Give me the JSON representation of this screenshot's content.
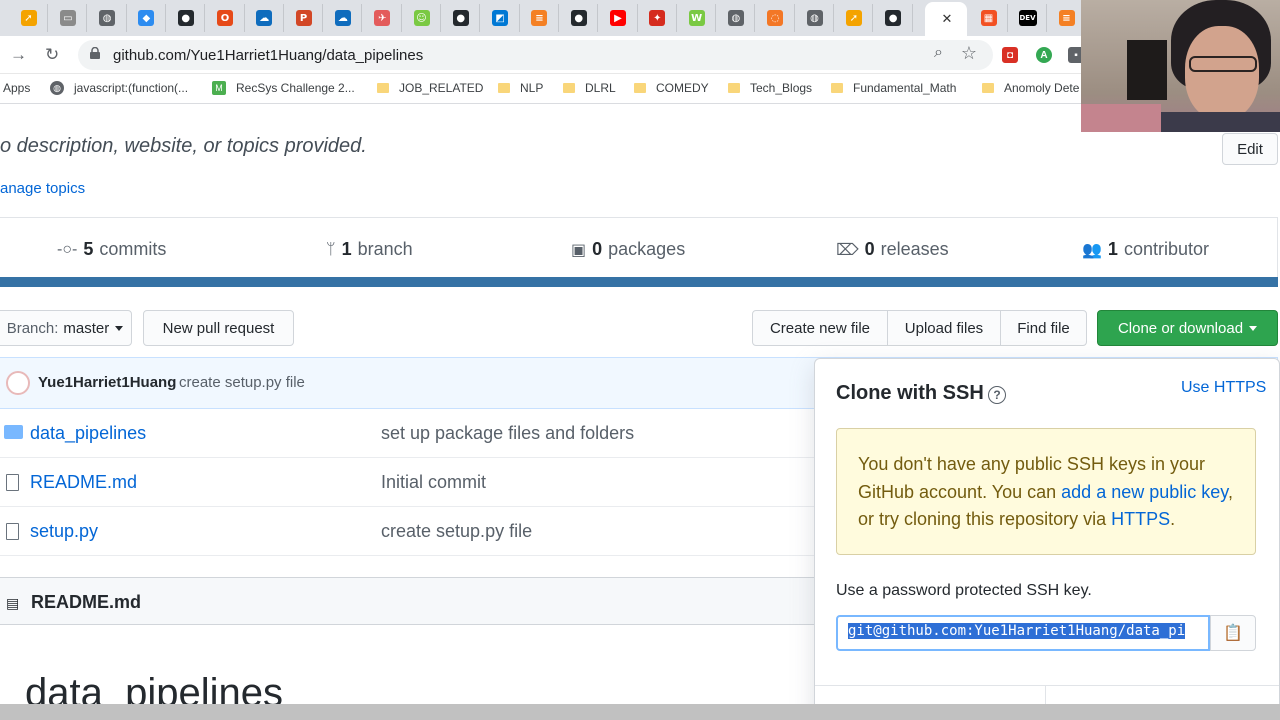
{
  "browser": {
    "url": "github.com/Yue1Harriet1Huang/data_pipelines",
    "tabs": [
      {
        "icon": "arrow-icon",
        "color": "#f4a300"
      },
      {
        "icon": "screen-icon",
        "color": "#8a8a8a"
      },
      {
        "icon": "globe-icon",
        "color": "#5f6368"
      },
      {
        "icon": "shield-icon",
        "color": "#2d8cf0"
      },
      {
        "icon": "github-icon",
        "color": "#24292e"
      },
      {
        "icon": "office-icon",
        "color": "#e64a19"
      },
      {
        "icon": "onedrive-icon",
        "color": "#0f6cbd"
      },
      {
        "icon": "powerpoint-icon",
        "color": "#d24726"
      },
      {
        "icon": "onedrive-icon",
        "color": "#0f6cbd"
      },
      {
        "icon": "paper-icon",
        "color": "#e35b5b"
      },
      {
        "icon": "smiley-icon",
        "color": "#7ac943"
      },
      {
        "icon": "github-icon",
        "color": "#24292e"
      },
      {
        "icon": "azure-icon",
        "color": "#0078d4"
      },
      {
        "icon": "stackoverflow-icon",
        "color": "#f48024"
      },
      {
        "icon": "github-icon",
        "color": "#24292e"
      },
      {
        "icon": "youtube-icon",
        "color": "#ff0000"
      },
      {
        "icon": "maple-leaf-icon",
        "color": "#d52b1e"
      },
      {
        "icon": "w-icon",
        "color": "#7ac943"
      },
      {
        "icon": "globe-icon",
        "color": "#5f6368"
      },
      {
        "icon": "jupyter-icon",
        "color": "#f37726"
      },
      {
        "icon": "globe-icon",
        "color": "#5f6368"
      },
      {
        "icon": "arrow-icon",
        "color": "#f4a300"
      },
      {
        "icon": "github-icon",
        "color": "#24292e"
      }
    ],
    "extra_tabs": [
      {
        "icon": "windows-icon",
        "color": "#f25022"
      },
      {
        "icon": "dev-icon",
        "color": "#000000",
        "label": "DEV"
      },
      {
        "icon": "stackoverflow-icon",
        "color": "#f48024"
      }
    ]
  },
  "bookmarks": [
    {
      "label": "Apps",
      "kind": "apps"
    },
    {
      "label": "javascript:(function(...",
      "kind": "globe"
    },
    {
      "label": "RecSys Challenge 2...",
      "kind": "m"
    },
    {
      "label": "JOB_RELATED",
      "kind": "folder"
    },
    {
      "label": "NLP",
      "kind": "folder"
    },
    {
      "label": "DLRL",
      "kind": "folder"
    },
    {
      "label": "COMEDY",
      "kind": "folder"
    },
    {
      "label": "Tech_Blogs",
      "kind": "folder"
    },
    {
      "label": "Fundamental_Math",
      "kind": "folder"
    },
    {
      "label": "Anomoly Dete",
      "kind": "folder"
    }
  ],
  "repo": {
    "description": "o description, website, or topics provided.",
    "manage_topics": "anage topics",
    "edit_label": "Edit",
    "stats": {
      "commits_count": "5",
      "commits_label": "commits",
      "branch_count": "1",
      "branch_label": "branch",
      "packages_count": "0",
      "packages_label": "packages",
      "releases_count": "0",
      "releases_label": "releases",
      "contributors_count": "1",
      "contributors_label": "contributor"
    },
    "branch_prefix": "Branch:",
    "branch_name": "master",
    "new_pr": "New pull request",
    "create_file": "Create new file",
    "upload_files": "Upload files",
    "find_file": "Find file",
    "clone_download": "Clone or download",
    "latest_commit": {
      "user": "Yue1Harriet1Huang",
      "message": "create setup.py file"
    },
    "files": [
      {
        "name": "data_pipelines",
        "message": "set up package files and folders",
        "type": "dir"
      },
      {
        "name": "README.md",
        "message": "Initial commit",
        "type": "file"
      },
      {
        "name": "setup.py",
        "message": "create setup.py file",
        "type": "file"
      }
    ],
    "readme_title": "README.md",
    "readme_heading": "data_pipelines"
  },
  "clone": {
    "title": "Clone with SSH",
    "use_https": "Use HTTPS",
    "flash_part1": "You don't have any public SSH keys in your GitHub account. You can ",
    "flash_link1": "add a new public key",
    "flash_part2": ", or try cloning this repository via ",
    "flash_link2": "HTTPS",
    "flash_part3": ".",
    "password_label": "Use a password protected SSH key.",
    "ssh_url": "git@github.com:Yue1Harriet1Huang/data_pi"
  }
}
